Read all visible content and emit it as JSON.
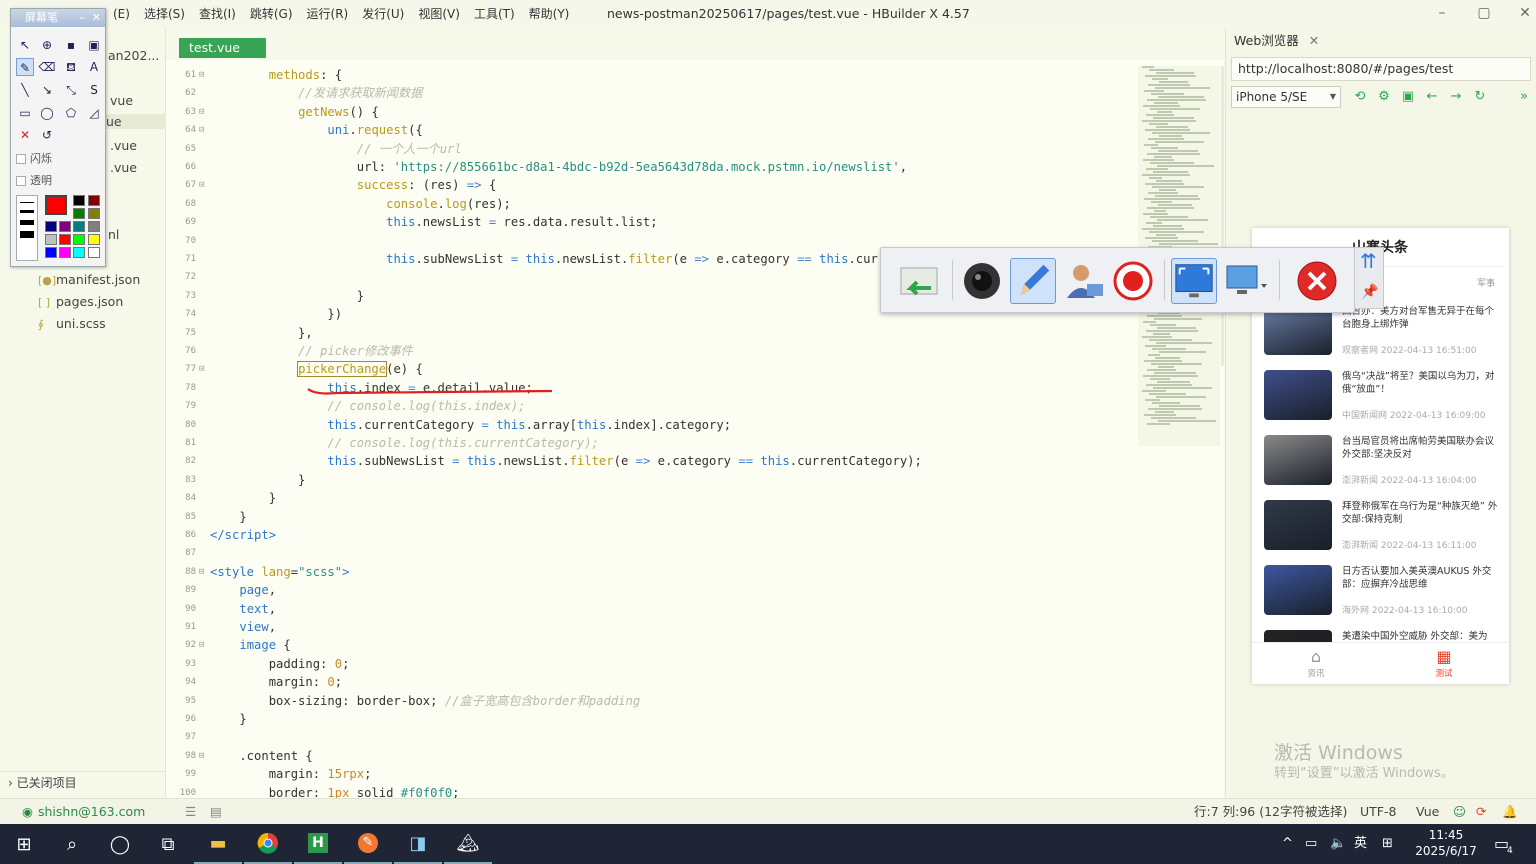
{
  "window": {
    "title": "news-postman20250617/pages/test.vue - HBuilder X 4.57",
    "menus": [
      "(E)",
      "选择(S)",
      "查找(I)",
      "跳转(G)",
      "运行(R)",
      "发行(U)",
      "视图(V)",
      "工具(T)",
      "帮助(Y)"
    ]
  },
  "sidebar": {
    "items": [
      {
        "label": "an202..."
      },
      {
        "label": "vue"
      },
      {
        "label": "ue"
      },
      {
        "label": ".vue"
      },
      {
        "label": ".vue"
      },
      {
        "label": "nl"
      },
      {
        "label": "manifest.json"
      },
      {
        "label": "pages.json"
      },
      {
        "label": "uni.scss"
      }
    ],
    "closed_projects": "已关闭项目"
  },
  "pen_tool": {
    "title": "屏幕笔",
    "flash_label": "闪烁",
    "transparent_label": "透明"
  },
  "editor": {
    "tab": "test.vue",
    "lines": [
      {
        "n": "61",
        "f": "⊟",
        "html": "        <span class='fn'>methods</span>: {"
      },
      {
        "n": "62",
        "f": "",
        "html": "            <span class='cm'>//发请求获取新闻数据</span>"
      },
      {
        "n": "63",
        "f": "⊟",
        "html": "            <span class='fn'>getNews</span>() {"
      },
      {
        "n": "64",
        "f": "⊟",
        "html": "                <span class='kw'>uni</span>.<span class='fn'>request</span>({"
      },
      {
        "n": "65",
        "f": "",
        "html": "                    <span class='cm'>// 一个人一个url</span>"
      },
      {
        "n": "66",
        "f": "",
        "html": "                    url: <span class='str'>'https://855661bc-d8a1-4bdc-b92d-5ea5643d78da.mock.pstmn.io/newslist'</span>,"
      },
      {
        "n": "67",
        "f": "⊟",
        "html": "                    <span class='fn'>success</span>: (res) <span class='op'>=&gt;</span> {"
      },
      {
        "n": "68",
        "f": "",
        "html": "                        <span class='fn'>console</span>.<span class='fn'>log</span>(res);"
      },
      {
        "n": "69",
        "f": "",
        "html": "                        <span class='kw'>this</span>.newsList <span class='op'>=</span> res.data.result.list;"
      },
      {
        "n": "70",
        "f": "",
        "html": ""
      },
      {
        "n": "71",
        "f": "",
        "html": "                        <span class='kw'>this</span>.subNewsList <span class='op'>=</span> <span class='kw'>this</span>.newsList.<span class='fn'>filter</span>(e <span class='op'>=&gt;</span> e.category <span class='op'>==</span> <span class='kw'>this</span>.curre"
      },
      {
        "n": "72",
        "f": "",
        "html": ""
      },
      {
        "n": "73",
        "f": "",
        "html": "                    }"
      },
      {
        "n": "74",
        "f": "",
        "html": "                })"
      },
      {
        "n": "75",
        "f": "",
        "html": "            },"
      },
      {
        "n": "76",
        "f": "",
        "html": "            <span class='cm'>// picker修改事件</span>"
      },
      {
        "n": "77",
        "f": "⊟",
        "html": "            <span class='fn' style='outline:1px solid #a08a30'>pickerChange</span>(e) {"
      },
      {
        "n": "78",
        "f": "",
        "html": "                <span class='kw'>this</span>.index <span class='op'>=</span> e.detail.value;"
      },
      {
        "n": "79",
        "f": "",
        "html": "                <span class='cm'>// console.log(this.index);</span>"
      },
      {
        "n": "80",
        "f": "",
        "html": "                <span class='kw'>this</span>.currentCategory <span class='op'>=</span> <span class='kw'>this</span>.array[<span class='kw'>this</span>.index].category;"
      },
      {
        "n": "81",
        "f": "",
        "html": "                <span class='cm'>// console.log(this.currentCategory);</span>"
      },
      {
        "n": "82",
        "f": "",
        "html": "                <span class='kw'>this</span>.subNewsList <span class='op'>=</span> <span class='kw'>this</span>.newsList.<span class='fn'>filter</span>(e <span class='op'>=&gt;</span> e.category <span class='op'>==</span> <span class='kw'>this</span>.currentCategory);"
      },
      {
        "n": "83",
        "f": "",
        "html": "            }"
      },
      {
        "n": "84",
        "f": "",
        "html": "        }"
      },
      {
        "n": "85",
        "f": "",
        "html": "    }"
      },
      {
        "n": "86",
        "f": "",
        "html": "<span class='tg'>&lt;/script&gt;</span>"
      },
      {
        "n": "87",
        "f": "",
        "html": ""
      },
      {
        "n": "88",
        "f": "⊟",
        "html": "<span class='tg'>&lt;style</span> <span class='fn'>lang</span>=<span class='str'>\"scss\"</span><span class='tg'>&gt;</span>"
      },
      {
        "n": "89",
        "f": "",
        "html": "    <span class='kw'>page</span>,"
      },
      {
        "n": "90",
        "f": "",
        "html": "    <span class='kw'>text</span>,"
      },
      {
        "n": "91",
        "f": "",
        "html": "    <span class='kw'>view</span>,"
      },
      {
        "n": "92",
        "f": "⊟",
        "html": "    <span class='kw'>image</span> {"
      },
      {
        "n": "93",
        "f": "",
        "html": "        padding: <span class='num2'>0</span>;"
      },
      {
        "n": "94",
        "f": "",
        "html": "        margin: <span class='num2'>0</span>;"
      },
      {
        "n": "95",
        "f": "",
        "html": "        box-sizing: border-box; <span class='cm'>//盒子宽高包含border和padding</span>"
      },
      {
        "n": "96",
        "f": "",
        "html": "    }"
      },
      {
        "n": "97",
        "f": "",
        "html": ""
      },
      {
        "n": "98",
        "f": "⊟",
        "html": "    .content {"
      },
      {
        "n": "99",
        "f": "",
        "html": "        margin: <span class='num2'>15rpx</span>;"
      },
      {
        "n": "100",
        "f": "",
        "html": "        border: <span class='num2'>1px</span> solid <span class='str'>#f0f0f0</span>;"
      }
    ]
  },
  "browser": {
    "tab": "Web浏览器",
    "url": "http://localhost:8080/#/pages/test",
    "device": "iPhone 5/SE",
    "app_title": "山寨头条",
    "category": "军事",
    "news": [
      {
        "title": "国台办：美方对台军售无异于在每个台胞身上绑炸弹",
        "source": "观察者网",
        "time": "2022-04-13 16:51:00",
        "color": "#6a7fa8"
      },
      {
        "title": "俄乌“决战”将至？美国以乌为刀，对俄“放血”！",
        "source": "中国新闻网",
        "time": "2022-04-13 16:09:00",
        "color": "#3f4f8a"
      },
      {
        "title": "台当局官员将出席帕劳美国联办会议 外交部:坚决反对",
        "source": "澎湃新闻",
        "time": "2022-04-13 16:04:00",
        "color": "#8a8a8a"
      },
      {
        "title": "拜登称俄军在乌行为是“种族灭绝” 外交部:保持克制",
        "source": "澎湃新闻",
        "time": "2022-04-13 16:11:00",
        "color": "#2f3a48"
      },
      {
        "title": "日方否认要加入美英澳AUKUS 外交部：应摒弃冷战思维",
        "source": "海外网",
        "time": "2022-04-13 16:10:00",
        "color": "#3c58a0"
      },
      {
        "title": "美遭染中国外空威胁 外交部：美为",
        "source": "",
        "time": "",
        "color": "#222222"
      }
    ],
    "tabs": [
      {
        "label": "资讯"
      },
      {
        "label": "测试"
      }
    ],
    "watermark_1": "激活 Windows",
    "watermark_2": "转到“设置”以激活 Windows。"
  },
  "status": {
    "user": "shishn@163.com",
    "position": "行:7  列:96 (12字符被选择)",
    "encoding": "UTF-8",
    "language": "Vue"
  },
  "taskbar": {
    "ime": "英",
    "time": "11:45",
    "date": "2025/6/17",
    "notif": "4"
  },
  "colors": {
    "accent": "#38a556",
    "annotation": "#e02020",
    "brand_red": "#e8412c"
  }
}
